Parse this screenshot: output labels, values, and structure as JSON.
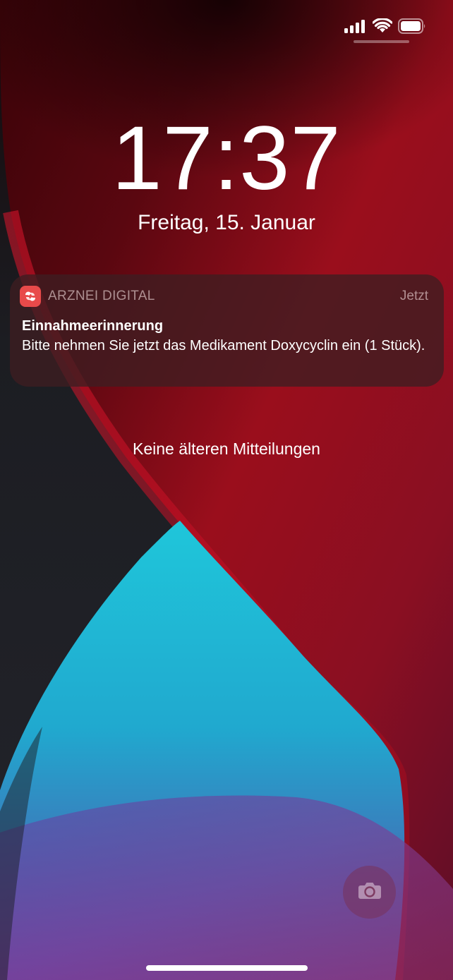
{
  "lock_screen": {
    "time": "17:37",
    "date": "Freitag, 15. Januar"
  },
  "status_bar": {
    "signal_icon": "cellular-signal-icon",
    "wifi_icon": "wifi-icon",
    "battery_icon": "battery-icon"
  },
  "notification": {
    "app_name": "ARZNEI DIGITAL",
    "time": "Jetzt",
    "title": "Einnahmeerinnerung",
    "body": "Bitte nehmen Sie jetzt das Medikament Doxycyclin ein (1 Stück).",
    "app_icon": "arznei-digital-app-icon",
    "accent_color": "#e84a4a"
  },
  "no_older_notifications": "Keine älteren Mitteilungen",
  "camera_icon": "camera-icon",
  "colors": {
    "wallpaper_red": "#c4142c",
    "wallpaper_cyan": "#1bc0d6",
    "wallpaper_purple": "#7a3d97",
    "wallpaper_dark": "#1a1c22"
  }
}
